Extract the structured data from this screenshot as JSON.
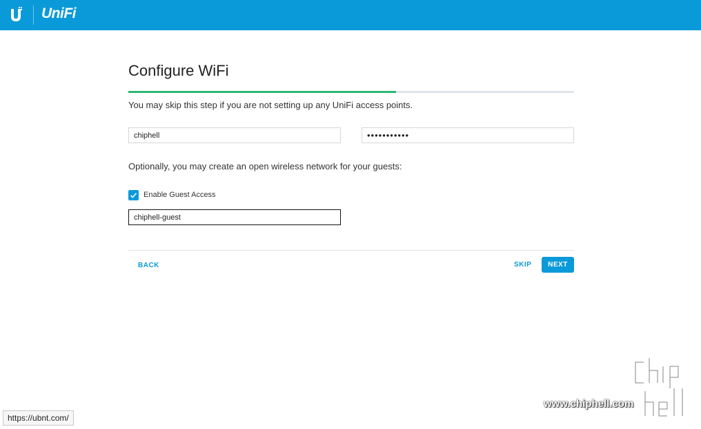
{
  "header": {
    "brand": "UniFi",
    "trademark": "™",
    "bg_color": "#0a9ad9"
  },
  "wizard": {
    "title": "Configure WiFi",
    "progress": 0.6,
    "skip_note": "You may skip this step if you are not setting up any UniFi access points.",
    "ssid_value": "chiphell",
    "password_value": "•••••••••••",
    "guest_note": "Optionally, you may create an open wireless network for your guests:",
    "guest_checkbox_label": "Enable Guest Access",
    "guest_checked": true,
    "guest_ssid_value": "chiphell-guest",
    "back_label": "BACK",
    "skip_label": "SKIP",
    "next_label": "NEXT",
    "accent_color": "#0a9ad9",
    "progress_color": "#2bb673"
  },
  "status_bar": {
    "url": "https://ubnt.com/"
  },
  "watermark": {
    "site": "www.chiphell.com",
    "logo_text": "chip hell"
  }
}
